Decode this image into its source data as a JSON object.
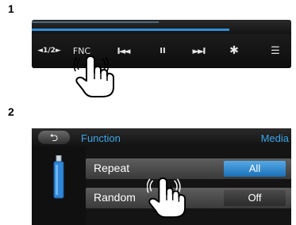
{
  "steps": {
    "first": "1",
    "second": "2"
  },
  "player_bar": {
    "page_indicator": "◄1/2►",
    "function_label": "FNC",
    "prev_label": "I◄◄",
    "pause_label": "II",
    "next_label": "►►I",
    "gear_icon": "gear-icon",
    "menu_icon": "menu-icon",
    "progress_fraction": 0.76
  },
  "function_menu": {
    "back_label": "⮌",
    "title": "Function",
    "source": "Media",
    "rows": [
      {
        "label": "Repeat",
        "value": "All"
      },
      {
        "label": "Random",
        "value": "Off"
      }
    ],
    "accent": "#3aa5e8",
    "selected_color": "#1b70b7"
  }
}
